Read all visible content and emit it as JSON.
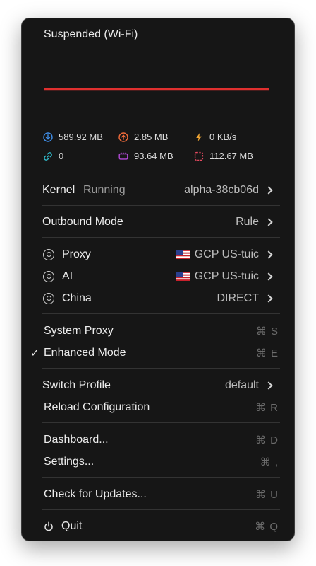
{
  "status": {
    "title": "Suspended (Wi-Fi)"
  },
  "stats": {
    "download_total": "589.92 MB",
    "upload_total": "2.85 MB",
    "speed": "0 KB/s",
    "connections": "0",
    "memory": "93.64 MB",
    "other": "112.67 MB"
  },
  "colors": {
    "chart_line": "#e0302f",
    "download": "#3f8ee8",
    "upload": "#ee6a3a",
    "speed": "#f2a633",
    "connections": "#30b8c8",
    "memory": "#b24ad6",
    "other": "#e64a60"
  },
  "kernel": {
    "label": "Kernel",
    "state": "Running",
    "version": "alpha-38cb06d"
  },
  "outbound": {
    "label": "Outbound Mode",
    "value": "Rule"
  },
  "groups": [
    {
      "name": "Proxy",
      "flag": "us-flag",
      "value": "GCP US-tuic"
    },
    {
      "name": "AI",
      "flag": "us-flag",
      "value": "GCP US-tuic"
    },
    {
      "name": "China",
      "value": "DIRECT"
    }
  ],
  "system_proxy": {
    "label": "System Proxy",
    "shortcut": "⌘ S"
  },
  "enhanced_mode": {
    "label": "Enhanced Mode",
    "shortcut": "⌘ E",
    "check": "✓"
  },
  "switch_profile": {
    "label": "Switch Profile",
    "value": "default"
  },
  "reload": {
    "label": "Reload Configuration",
    "shortcut": "⌘ R"
  },
  "dashboard": {
    "label": "Dashboard...",
    "shortcut": "⌘ D"
  },
  "settings": {
    "label": "Settings...",
    "shortcut": "⌘ ,"
  },
  "updates": {
    "label": "Check for Updates...",
    "shortcut": "⌘ U"
  },
  "quit": {
    "label": "Quit",
    "shortcut": "⌘ Q"
  }
}
